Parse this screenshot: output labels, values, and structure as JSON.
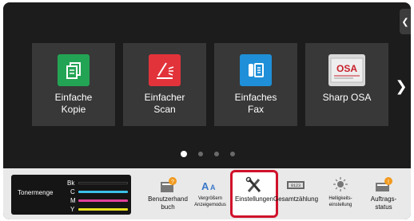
{
  "tiles": [
    {
      "label": "Einfache\nKopie",
      "icon": "copy-icon",
      "color": "#23a454"
    },
    {
      "label": "Einfacher\nScan",
      "icon": "scan-icon",
      "color": "#e2333b"
    },
    {
      "label": "Einfaches\nFax",
      "icon": "fax-icon",
      "color": "#1e8fd8"
    },
    {
      "label": "Sharp OSA",
      "icon": "sharp-osa-icon",
      "color": "#d9d9d9",
      "logo_text": "OSA"
    }
  ],
  "pager": {
    "count": 4,
    "active": 0
  },
  "toner": {
    "label": "Tonermenge",
    "rows": [
      {
        "letter": "Bk",
        "color": "#000000"
      },
      {
        "letter": "C",
        "color": "#39c0e8"
      },
      {
        "letter": "M",
        "color": "#e0409a"
      },
      {
        "letter": "Y",
        "color": "#e8e020"
      }
    ]
  },
  "shortcuts": [
    {
      "label": "Benutzerhand\nbuch",
      "icon": "manual-icon",
      "small": false
    },
    {
      "label": "Vergrößern\nAnzeigemodus",
      "icon": "zoom-text-icon",
      "small": true
    },
    {
      "label": "Einstellungen",
      "icon": "settings-tools-icon",
      "small": false,
      "highlighted": true
    },
    {
      "label": "Gesamtzählung",
      "icon": "counter-icon",
      "small": false
    },
    {
      "label": "Helligkeits-\neinstellung",
      "icon": "brightness-icon",
      "small": true
    },
    {
      "label": "Auftrags-\nstatus",
      "icon": "job-status-icon",
      "small": false
    }
  ],
  "colors": {
    "highlight": "#d0122b",
    "badge": "#f29a1f"
  }
}
